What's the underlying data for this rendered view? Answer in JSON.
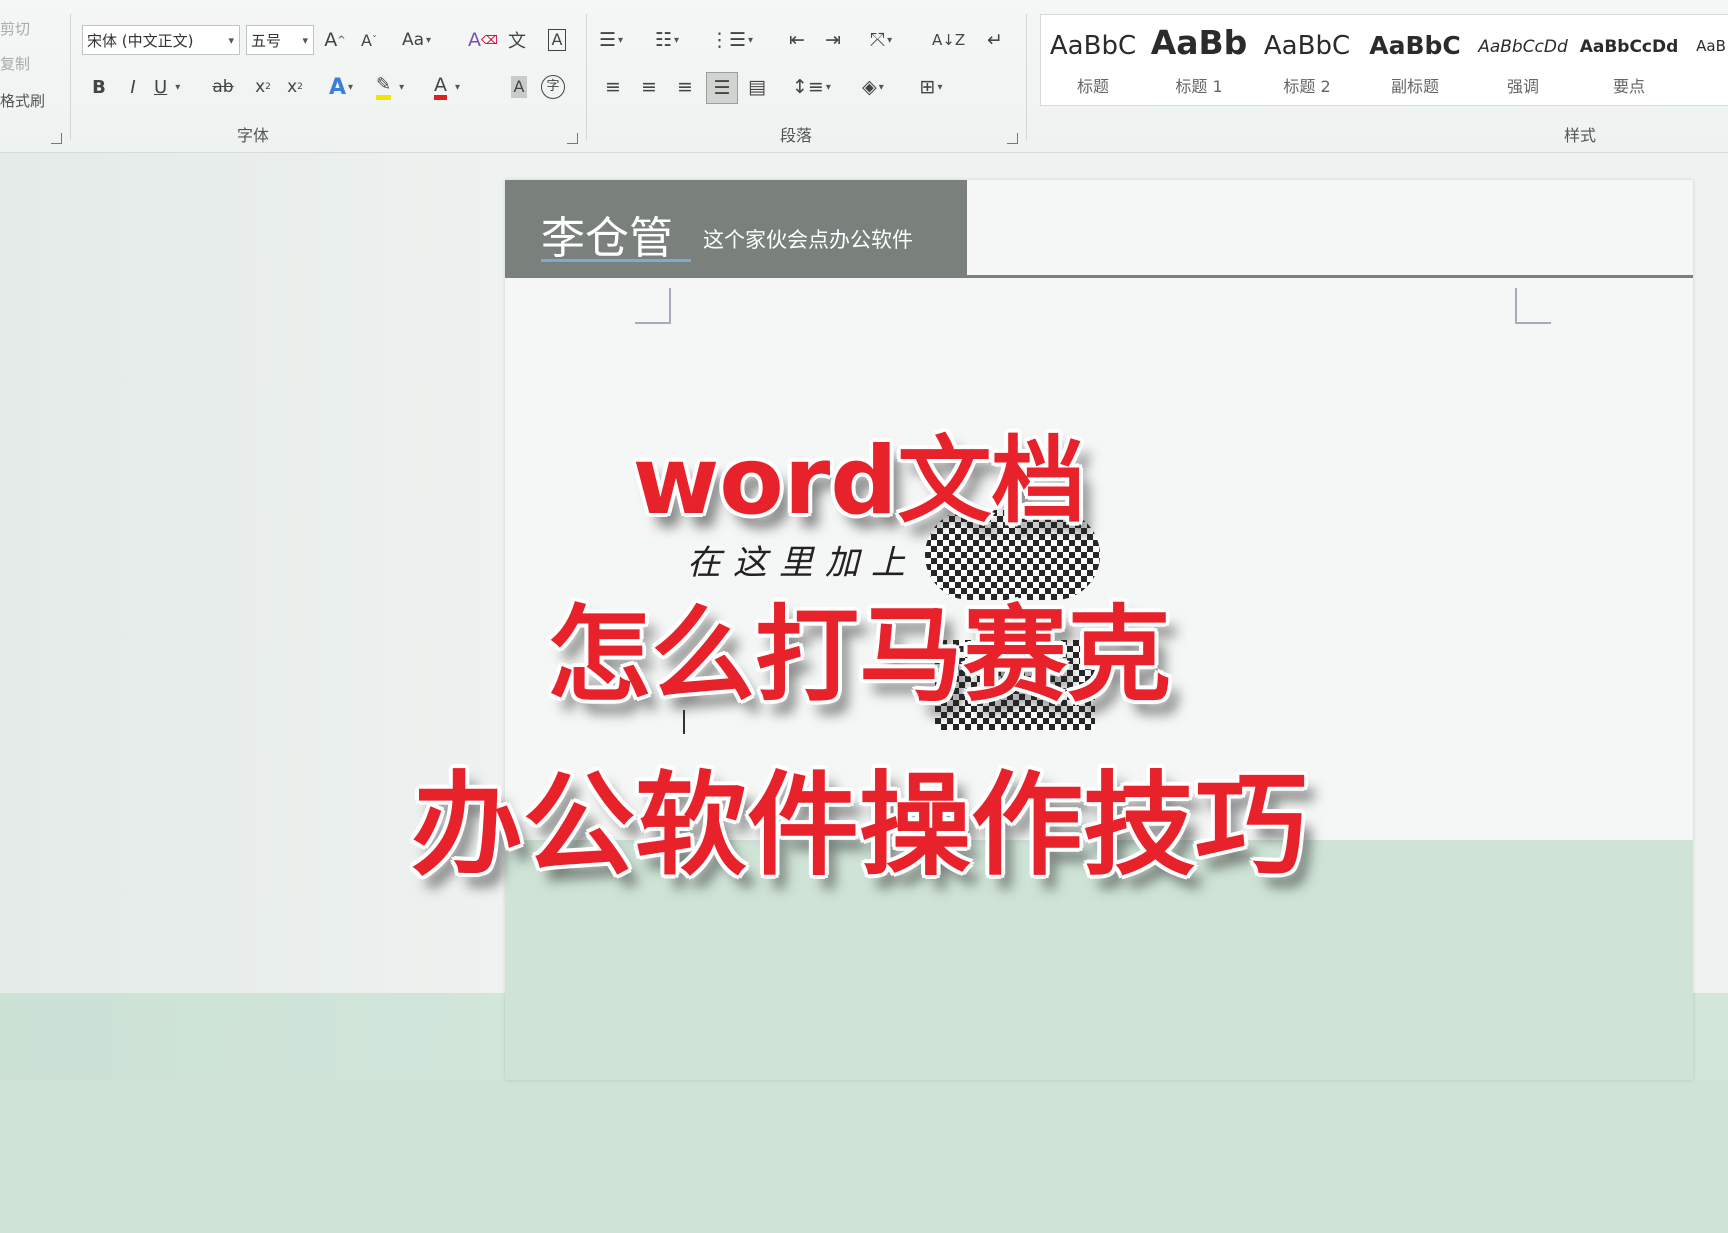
{
  "clipboard": {
    "items": [
      "剪切",
      "复制",
      "格式刷"
    ]
  },
  "font_group": {
    "label": "字体",
    "font_name": "宋体 (中文正文)",
    "font_size": "五号",
    "grow_font": "A",
    "shrink_font": "A",
    "change_case": "Aa",
    "bold": "B",
    "italic": "I",
    "underline": "U",
    "strikethrough": "ab",
    "subscript": "x",
    "superscript": "x",
    "text_effect": "A",
    "font_color": "A",
    "char_shading": "A",
    "enclose": "字",
    "phonetic": "文",
    "char_border": "A"
  },
  "paragraph_group": {
    "label": "段落"
  },
  "styles_group": {
    "label": "样式",
    "items": [
      {
        "preview": "AaBbC",
        "name": "标题"
      },
      {
        "preview": "AaBb",
        "name": "标题 1"
      },
      {
        "preview": "AaBbC",
        "name": "标题 2"
      },
      {
        "preview": "AaBbC",
        "name": "副标题"
      },
      {
        "preview": "AaBbCcDd",
        "name": "强调"
      },
      {
        "preview": "AaBbCcDd",
        "name": "要点"
      },
      {
        "preview": "AaB",
        "name": ""
      }
    ]
  },
  "document": {
    "header_name": "李仓管",
    "header_subtitle": "这个家伙会点办公软件",
    "handwritten_text": "在这里加上"
  },
  "overlay": {
    "line1": "word文档",
    "line2": "怎么打马赛克",
    "line3": "办公软件操作技巧"
  },
  "colors": {
    "overlay_text": "#e8222a",
    "header_band": "#7a807c",
    "highlight": "#f5e400",
    "font_color": "#e02020"
  }
}
